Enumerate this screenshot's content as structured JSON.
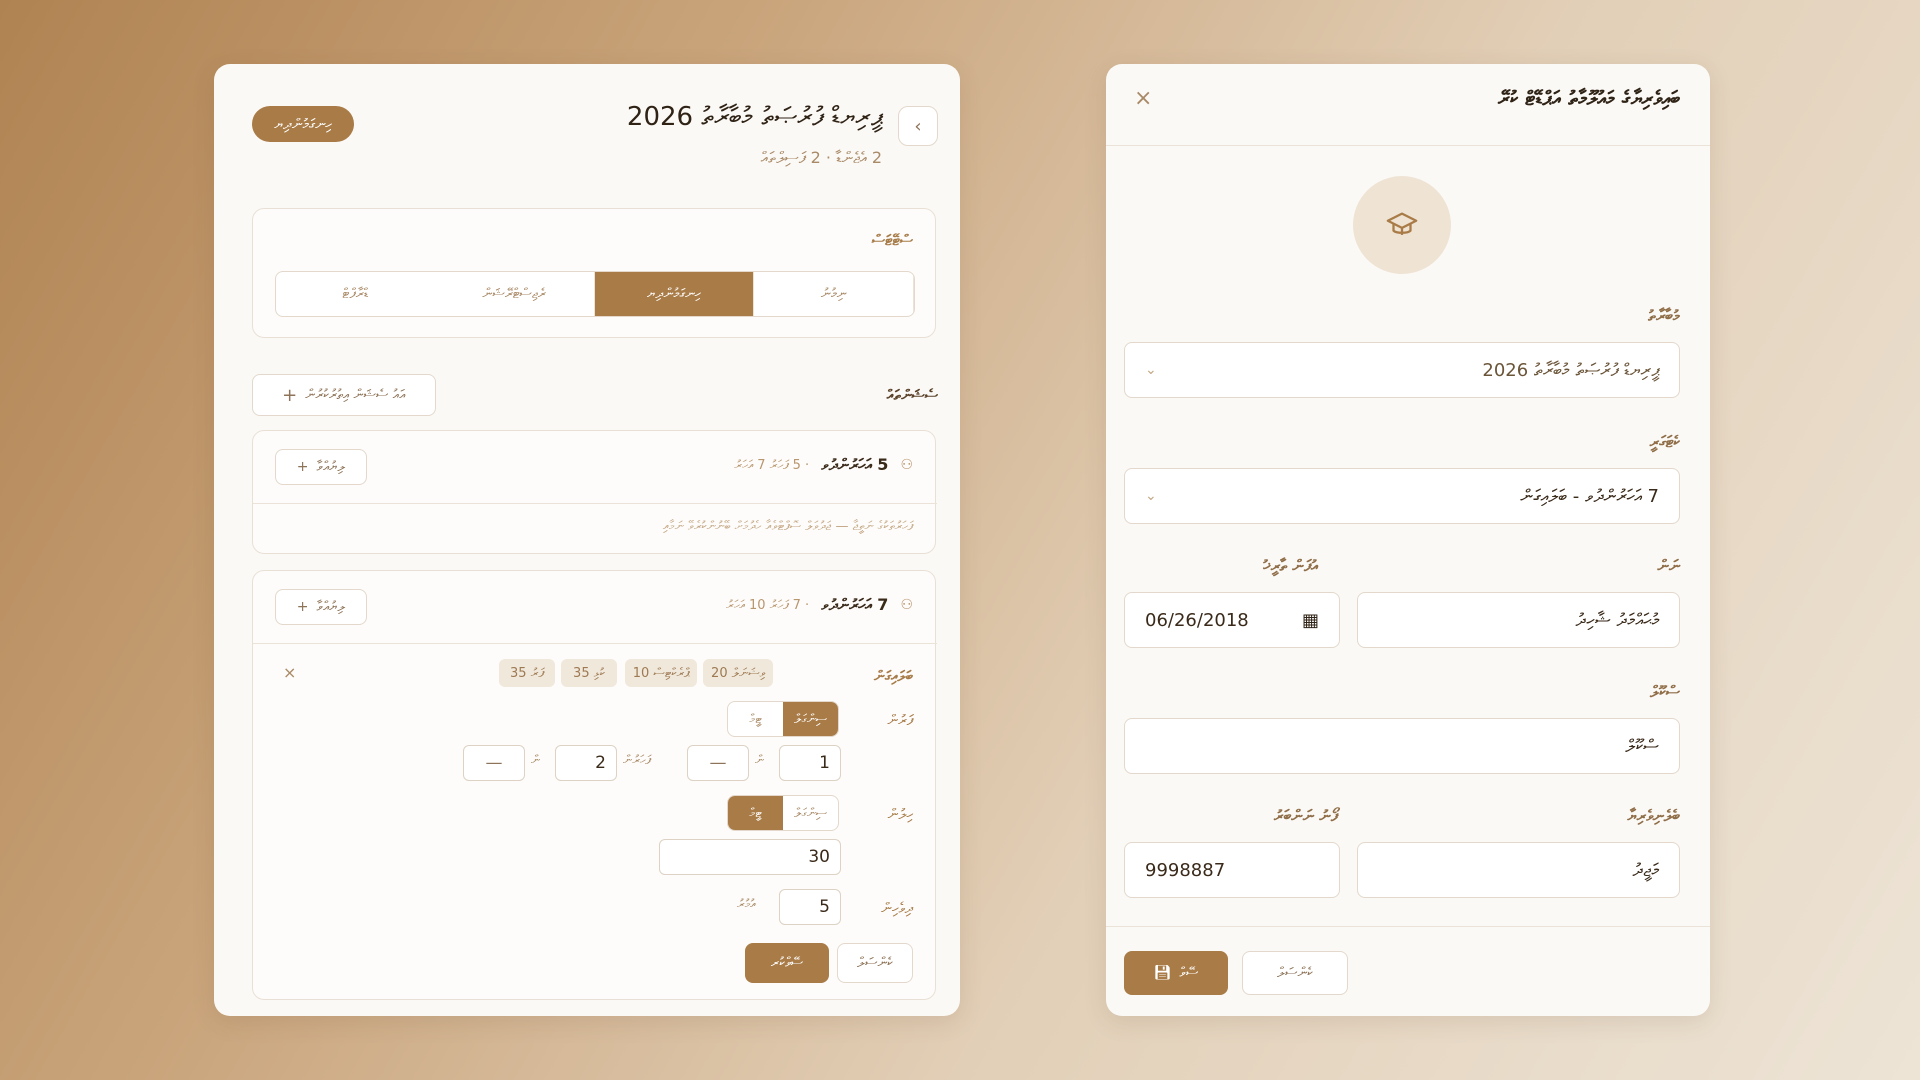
{
  "left": {
    "pill_label": "ހިނގަމުންދިޔ",
    "title": "ޕީރިޔޑް ފުރުޞަތު މުބާރާތު 2026",
    "subtitle": "2 އެޖެންޑާ · 2 ފަސިލްތައް",
    "status": {
      "heading": "ސްޓޭޓަސް",
      "options": [
        "ނިމުނު",
        "ހިނގަމުންދިޔ",
        "ރެޖިސްޓްރޭޝަން",
        "ޑްރާފްޓް"
      ],
      "active_index": 1
    },
    "sessions": {
      "heading": "ސެޝަންތައް",
      "add_label": "އައު ސެޝަން އިތުރުކުރުން"
    },
    "session1": {
      "title": "5 އަހަރުންދުވ",
      "meta": "· 5 ފަހަރު 7 އަހަރު",
      "add_label": "ލިޔުއްވާ",
      "note": "ފަހަރުތަކުގެ ނަތީޖާ — ޖަދުވަލް ސޮފްޓްވެއާ ހެދުމަށް ބޭނުންކުރެވޭ ނަމާއި"
    },
    "session2": {
      "title": "7 އަހަރުންދުވ",
      "meta": "· 7 ފަހަރު 10 އަހަރު",
      "add_label": "ލިޔުއްވާ",
      "chips_label": "ބަލައިގަން",
      "chips": [
        "ވިޝަނަލް 20",
        "ޕްރެކްޓިސް 10",
        "ކުޅި 35",
        "ފަރު 35"
      ],
      "row1_label": "ފަރުން",
      "row1_toggle": [
        "ސިންގަލް",
        "ޓީމް"
      ],
      "row1_values": [
        "1",
        "—",
        "2",
        "—"
      ],
      "row1_unit_a": "ން",
      "row1_unit_b": "ފަހަރުން",
      "row1_unit_c": "ން",
      "row2_label": "ހިލުން",
      "row2_toggle": [
        "ސިންގަލް",
        "ޓީމް"
      ],
      "row2_value": "30",
      "row3_label": "ދިވެހިން",
      "row3_value": "5",
      "row3_unit": "އުމުރު",
      "cancel_label": "ކެންސަލް",
      "save_label": "ސޭވްކުރ"
    }
  },
  "right": {
    "title": "ބައިވެރިޔާގެ މައުލޫމާތު އަޕްޑޭޓް ކުރޭ",
    "competition_label": "މުބާރާތު",
    "competition_value": "ޕީރިޔޑް ފުރުޞަތު މުބާރާތު 2026",
    "category_label": "ކެޓަގަރީ",
    "category_value": "7 އަހަރުންދުވ - ބަލައިގަން",
    "name_label": "ނަން",
    "name_value": "މުޙައްމަދު ޝާހިދު",
    "dob_label": "އުފަން ތާރީޚު",
    "dob_value": "06/26/2018",
    "school_label": "ސްކޫލް",
    "school_value": "ސްކޫލް",
    "guardian_label": "ބެލެނިވެރިޔާ",
    "guardian_value": "މަޖީދު",
    "phone_label": "ފޯނު ނަންބަރު",
    "phone_value": "9998887",
    "cancel_label": "ކެންސަލް",
    "save_label": "ސޭވް"
  },
  "colors": {
    "accent": "#a97b47",
    "panel": "#fbf9f6"
  }
}
